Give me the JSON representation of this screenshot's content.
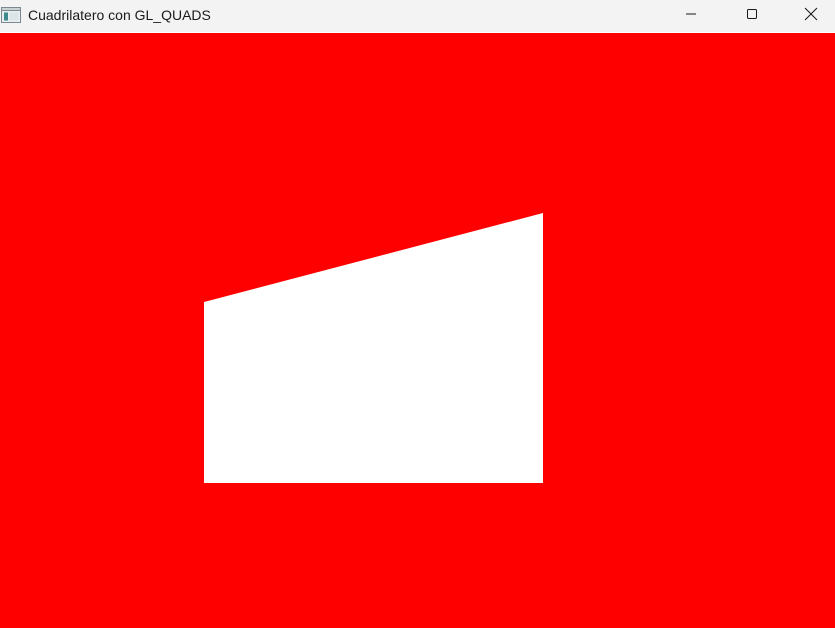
{
  "window": {
    "title": "Cuadrilatero con GL_QUADS",
    "app_icon": "app-window-icon",
    "controls": {
      "minimize_icon": "minimize-icon",
      "maximize_icon": "maximize-icon",
      "close_icon": "close-icon"
    }
  },
  "canvas": {
    "background_color": "#ff0000",
    "shape": {
      "type": "quadrilateral",
      "fill_color": "#ffffff"
    }
  }
}
